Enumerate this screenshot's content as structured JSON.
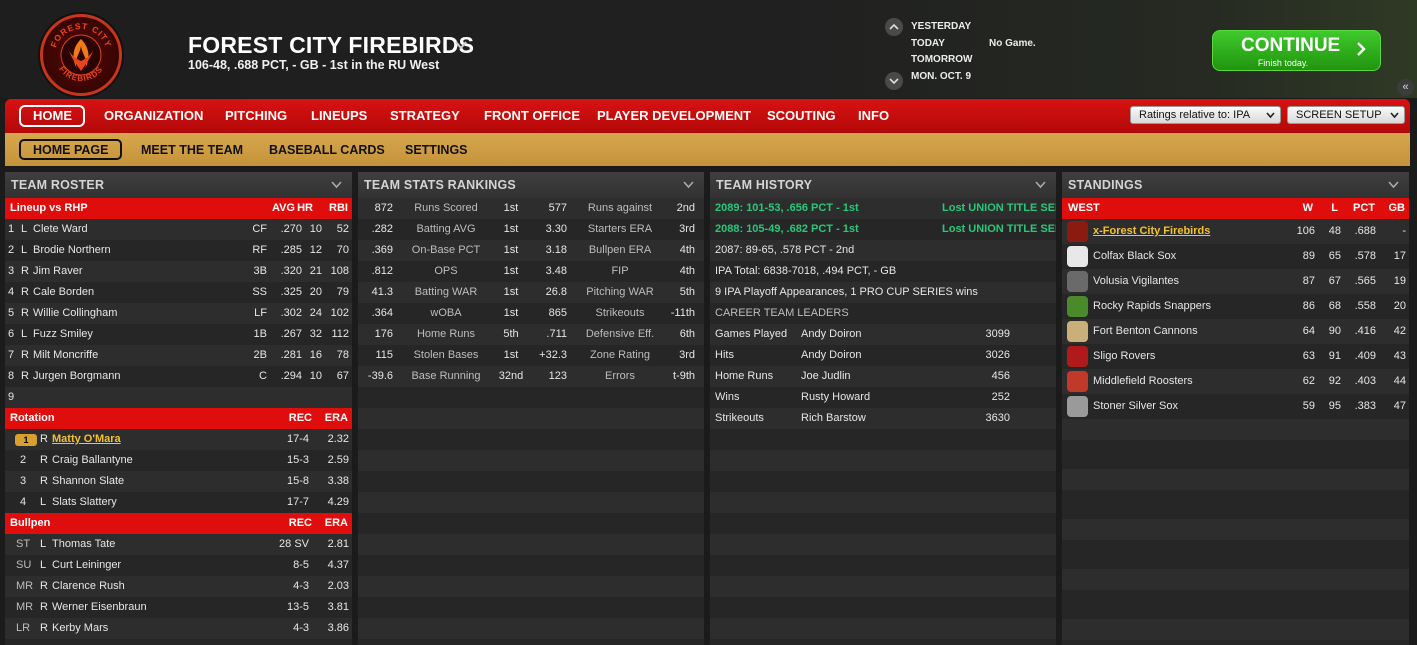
{
  "header": {
    "team_name": "FOREST CITY FIREBIRDS",
    "logo_text": "FOREST CITY FIREBIRDS",
    "record_line": "106-48, .688 PCT, - GB - 1st in the RU West",
    "days": [
      {
        "label": "YESTERDAY",
        "result": ""
      },
      {
        "label": "TODAY",
        "result": "No Game."
      },
      {
        "label": "TOMORROW",
        "result": ""
      },
      {
        "label": "MON. OCT. 9",
        "result": ""
      }
    ],
    "continue_label": "CONTINUE",
    "continue_sub": "Finish today.",
    "collapse_glyph": "«"
  },
  "nav": {
    "items": [
      "HOME",
      "ORGANIZATION",
      "PITCHING",
      "LINEUPS",
      "STRATEGY",
      "FRONT OFFICE",
      "PLAYER DEVELOPMENT",
      "SCOUTING",
      "INFO"
    ],
    "ratings_select": "Ratings relative to: IPA",
    "screen_setup": "SCREEN SETUP"
  },
  "subnav": {
    "items": [
      "HOME PAGE",
      "MEET THE TEAM",
      "BASEBALL CARDS",
      "SETTINGS"
    ]
  },
  "roster": {
    "title": "TEAM ROSTER",
    "lineup_header": {
      "label": "Lineup vs RHP",
      "avg": "AVG",
      "hr": "HR",
      "rbi": "RBI"
    },
    "lineup": [
      {
        "num": "1",
        "hand": "L",
        "name": "Clete Ward",
        "pos": "CF",
        "avg": ".270",
        "hr": "10",
        "rbi": "52"
      },
      {
        "num": "2",
        "hand": "L",
        "name": "Brodie Northern",
        "pos": "RF",
        "avg": ".285",
        "hr": "12",
        "rbi": "70"
      },
      {
        "num": "3",
        "hand": "R",
        "name": "Jim Raver",
        "pos": "3B",
        "avg": ".320",
        "hr": "21",
        "rbi": "108"
      },
      {
        "num": "4",
        "hand": "R",
        "name": "Cale Borden",
        "pos": "SS",
        "avg": ".325",
        "hr": "20",
        "rbi": "79"
      },
      {
        "num": "5",
        "hand": "R",
        "name": "Willie Collingham",
        "pos": "LF",
        "avg": ".302",
        "hr": "24",
        "rbi": "102"
      },
      {
        "num": "6",
        "hand": "L",
        "name": "Fuzz Smiley",
        "pos": "1B",
        "avg": ".267",
        "hr": "32",
        "rbi": "112"
      },
      {
        "num": "7",
        "hand": "R",
        "name": "Milt Moncriffe",
        "pos": "2B",
        "avg": ".281",
        "hr": "16",
        "rbi": "78"
      },
      {
        "num": "8",
        "hand": "R",
        "name": "Jurgen Borgmann",
        "pos": "C",
        "avg": ".294",
        "hr": "10",
        "rbi": "67"
      },
      {
        "num": "9",
        "hand": "",
        "name": "",
        "pos": "",
        "avg": "",
        "hr": "",
        "rbi": ""
      }
    ],
    "rotation_header": {
      "label": "Rotation",
      "rec": "REC",
      "era": "ERA"
    },
    "rotation": [
      {
        "num": "1",
        "hand": "R",
        "name": "Matty O'Mara",
        "rec": "17-4",
        "era": "2.32"
      },
      {
        "num": "2",
        "hand": "R",
        "name": "Craig Ballantyne",
        "rec": "15-3",
        "era": "2.59"
      },
      {
        "num": "3",
        "hand": "R",
        "name": "Shannon Slate",
        "rec": "15-8",
        "era": "3.38"
      },
      {
        "num": "4",
        "hand": "L",
        "name": "Slats Slattery",
        "rec": "17-7",
        "era": "4.29"
      }
    ],
    "bullpen_header": {
      "label": "Bullpen",
      "rec": "REC",
      "era": "ERA"
    },
    "bullpen": [
      {
        "role": "ST",
        "hand": "L",
        "name": "Thomas Tate",
        "rec": "28 SV",
        "era": "2.81"
      },
      {
        "role": "SU",
        "hand": "L",
        "name": "Curt Leininger",
        "rec": "8-5",
        "era": "4.37"
      },
      {
        "role": "MR",
        "hand": "R",
        "name": "Clarence Rush",
        "rec": "4-3",
        "era": "2.03"
      },
      {
        "role": "MR",
        "hand": "R",
        "name": "Werner Eisenbraun",
        "rec": "13-5",
        "era": "3.81"
      },
      {
        "role": "LR",
        "hand": "R",
        "name": "Kerby Mars",
        "rec": "4-3",
        "era": "3.86"
      }
    ]
  },
  "stats": {
    "title": "TEAM STATS RANKINGS",
    "rows": [
      {
        "v1": "872",
        "l1": "Runs Scored",
        "r1": "1st",
        "v2": "577",
        "l2": "Runs against",
        "r2": "2nd"
      },
      {
        "v1": ".282",
        "l1": "Batting AVG",
        "r1": "1st",
        "v2": "3.30",
        "l2": "Starters ERA",
        "r2": "3rd"
      },
      {
        "v1": ".369",
        "l1": "On-Base PCT",
        "r1": "1st",
        "v2": "3.18",
        "l2": "Bullpen ERA",
        "r2": "4th"
      },
      {
        "v1": ".812",
        "l1": "OPS",
        "r1": "1st",
        "v2": "3.48",
        "l2": "FIP",
        "r2": "4th"
      },
      {
        "v1": "41.3",
        "l1": "Batting WAR",
        "r1": "1st",
        "v2": "26.8",
        "l2": "Pitching WAR",
        "r2": "5th"
      },
      {
        "v1": ".364",
        "l1": "wOBA",
        "r1": "1st",
        "v2": "865",
        "l2": "Strikeouts",
        "r2": "-11th"
      },
      {
        "v1": "176",
        "l1": "Home Runs",
        "r1": "5th",
        "v2": ".711",
        "l2": "Defensive Eff.",
        "r2": "6th"
      },
      {
        "v1": "115",
        "l1": "Stolen Bases",
        "r1": "1st",
        "v2": "+32.3",
        "l2": "Zone Rating",
        "r2": "3rd"
      },
      {
        "v1": "-39.6",
        "l1": "Base Running",
        "r1": "32nd",
        "v2": "123",
        "l2": "Errors",
        "r2": "t-9th"
      }
    ]
  },
  "history": {
    "title": "TEAM HISTORY",
    "seasons": [
      {
        "text": "2089: 101-53, .656 PCT - 1st",
        "note": "Lost UNION TITLE SER"
      },
      {
        "text": "2088: 105-49, .682 PCT - 1st",
        "note": "Lost UNION TITLE SER"
      },
      {
        "text": "2087: 89-65, .578 PCT - 2nd",
        "note": ""
      }
    ],
    "total": "IPA Total: 6838-7018, .494 PCT, - GB",
    "playoffs": "9 IPA Playoff Appearances, 1 PRO CUP SERIES wins",
    "leaders_title": "CAREER TEAM LEADERS",
    "leaders": [
      {
        "cat": "Games Played",
        "name": "Andy Doiron",
        "val": "3099"
      },
      {
        "cat": "Hits",
        "name": "Andy Doiron",
        "val": "3026"
      },
      {
        "cat": "Home Runs",
        "name": "Joe Judlin",
        "val": "456"
      },
      {
        "cat": "Wins",
        "name": "Rusty Howard",
        "val": "252"
      },
      {
        "cat": "Strikeouts",
        "name": "Rich Barstow",
        "val": "3630"
      }
    ]
  },
  "standings": {
    "title": "STANDINGS",
    "header": {
      "div": "WEST",
      "w": "W",
      "l": "L",
      "pct": "PCT",
      "gb": "GB"
    },
    "teams": [
      {
        "name": "x-Forest City Firebirds",
        "w": "106",
        "l": "48",
        "pct": ".688",
        "gb": "-",
        "icon": "firebird-logo",
        "color": "#8b1a10"
      },
      {
        "name": "Colfax Black Sox",
        "w": "89",
        "l": "65",
        "pct": ".578",
        "gb": "17",
        "icon": "diamond-logo",
        "color": "#e8e8e8"
      },
      {
        "name": "Volusia Vigilantes",
        "w": "87",
        "l": "67",
        "pct": ".565",
        "gb": "19",
        "icon": "vigilante-logo",
        "color": "#6a6a6a"
      },
      {
        "name": "Rocky Rapids Snappers",
        "w": "86",
        "l": "68",
        "pct": ".558",
        "gb": "20",
        "icon": "rr-logo",
        "color": "#4b8a2a"
      },
      {
        "name": "Fort Benton Cannons",
        "w": "64",
        "l": "90",
        "pct": ".416",
        "gb": "42",
        "icon": "cannon-logo",
        "color": "#c9b07a"
      },
      {
        "name": "Sligo Rovers",
        "w": "63",
        "l": "91",
        "pct": ".409",
        "gb": "43",
        "icon": "rovers-logo",
        "color": "#b11a1a"
      },
      {
        "name": "Middlefield Roosters",
        "w": "62",
        "l": "92",
        "pct": ".403",
        "gb": "44",
        "icon": "rooster-logo",
        "color": "#c0392b"
      },
      {
        "name": "Stoner Silver Sox",
        "w": "59",
        "l": "95",
        "pct": ".383",
        "gb": "47",
        "icon": "sock-logo",
        "color": "#9a9a9a"
      }
    ]
  },
  "colors": {
    "nav_red": "#d81212",
    "subnav_gold": "#d7a74d",
    "continue_green": "#3fca2c",
    "link_gold": "#f2c230",
    "history_green": "#28c87a"
  }
}
